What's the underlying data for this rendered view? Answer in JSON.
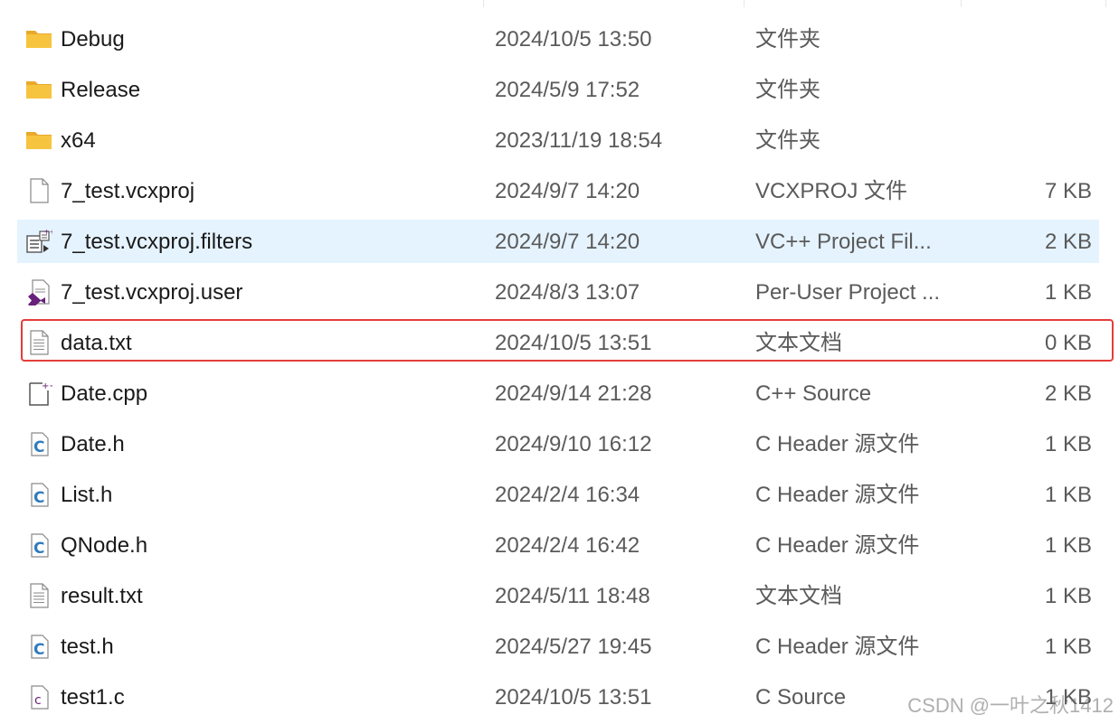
{
  "colors": {
    "hover_background": "#e5f3ff",
    "selection_border": "#e43d3a",
    "folder": "#f7c440",
    "vs_purple": "#68217a",
    "c_header_blue": "#2f7bbd"
  },
  "files": [
    {
      "name": "Debug",
      "date": "2024/10/5 13:50",
      "type": "文件夹",
      "size": "",
      "icon": "folder-icon"
    },
    {
      "name": "Release",
      "date": "2024/5/9 17:52",
      "type": "文件夹",
      "size": "",
      "icon": "folder-icon"
    },
    {
      "name": "x64",
      "date": "2023/11/19 18:54",
      "type": "文件夹",
      "size": "",
      "icon": "folder-icon"
    },
    {
      "name": "7_test.vcxproj",
      "date": "2024/9/7 14:20",
      "type": "VCXPROJ 文件",
      "size": "7 KB",
      "icon": "blank-file-icon"
    },
    {
      "name": "7_test.vcxproj.filters",
      "date": "2024/9/7 14:20",
      "type": "VC++ Project Fil...",
      "size": "2 KB",
      "icon": "vcxproj-filters-icon",
      "hovered": true
    },
    {
      "name": "7_test.vcxproj.user",
      "date": "2024/8/3 13:07",
      "type": "Per-User Project ...",
      "size": "1 KB",
      "icon": "visual-studio-file-icon"
    },
    {
      "name": "data.txt",
      "date": "2024/10/5 13:51",
      "type": "文本文档",
      "size": "0 KB",
      "icon": "text-file-icon",
      "selected": true
    },
    {
      "name": "Date.cpp",
      "date": "2024/9/14 21:28",
      "type": "C++ Source",
      "size": "2 KB",
      "icon": "cpp-source-icon"
    },
    {
      "name": "Date.h",
      "date": "2024/9/10 16:12",
      "type": "C Header 源文件",
      "size": "1 KB",
      "icon": "c-header-icon"
    },
    {
      "name": "List.h",
      "date": "2024/2/4 16:34",
      "type": "C Header 源文件",
      "size": "1 KB",
      "icon": "c-header-icon"
    },
    {
      "name": "QNode.h",
      "date": "2024/2/4 16:42",
      "type": "C Header 源文件",
      "size": "1 KB",
      "icon": "c-header-icon"
    },
    {
      "name": "result.txt",
      "date": "2024/5/11 18:48",
      "type": "文本文档",
      "size": "1 KB",
      "icon": "text-file-icon"
    },
    {
      "name": "test.h",
      "date": "2024/5/27 19:45",
      "type": "C Header 源文件",
      "size": "1 KB",
      "icon": "c-header-icon"
    },
    {
      "name": "test1.c",
      "date": "2024/10/5 13:51",
      "type": "C Source",
      "size": "1 KB",
      "icon": "c-source-icon"
    }
  ],
  "watermark": "CSDN @一叶之秋1412"
}
